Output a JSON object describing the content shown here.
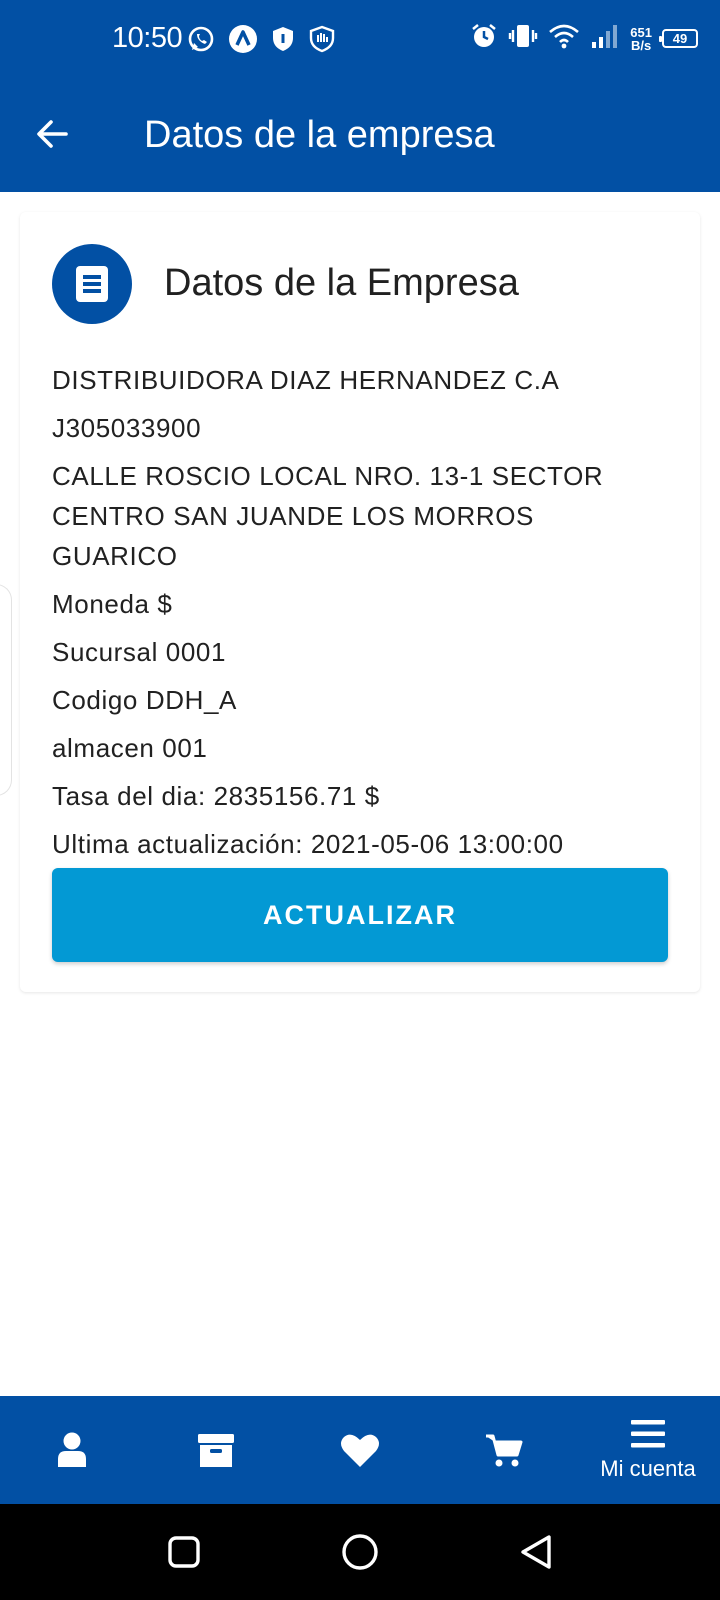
{
  "status_bar": {
    "time": "10:50",
    "net_speed_value": "651",
    "net_speed_unit": "B/s",
    "battery_level": "49",
    "icons": [
      "whatsapp-icon",
      "app-a-icon",
      "shield-icon",
      "hand-shield-icon",
      "alarm-icon",
      "vibrate-icon",
      "wifi-icon",
      "signal-icon"
    ]
  },
  "app_bar": {
    "title": "Datos de la empresa"
  },
  "card": {
    "title": "Datos de la Empresa",
    "company_name": "DISTRIBUIDORA DIAZ HERNANDEZ C.A",
    "rif": "J305033900",
    "address": "CALLE ROSCIO LOCAL NRO. 13-1 SECTOR CENTRO SAN JUANDE LOS MORROS GUARICO",
    "currency": "Moneda $",
    "branch": "Sucursal 0001",
    "code": "Codigo DDH_A",
    "warehouse": "almacen 001",
    "rate": "Tasa del dia: 2835156.71 $",
    "last_update": "Ultima actualización: 2021-05-06 13:00:00",
    "update_button": "ACTUALIZAR"
  },
  "bottom_nav": {
    "items": [
      {
        "icon": "user-icon",
        "label": ""
      },
      {
        "icon": "archive-icon",
        "label": ""
      },
      {
        "icon": "heart-icon",
        "label": ""
      },
      {
        "icon": "cart-icon",
        "label": ""
      },
      {
        "icon": "menu-icon",
        "label": "Mi cuenta"
      }
    ]
  },
  "colors": {
    "primary": "#0250a4",
    "button": "#0399d4"
  }
}
